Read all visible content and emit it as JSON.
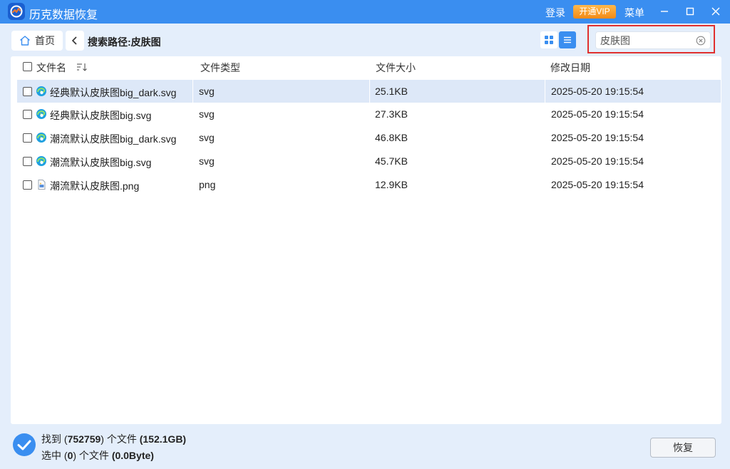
{
  "titlebar": {
    "app_title": "历克数据恢复",
    "login": "登录",
    "vip": "开通VIP",
    "menu": "菜单",
    "accent_color": "#3a8ef0"
  },
  "toolbar": {
    "home_label": "首页",
    "path_label": "搜索路径:",
    "path_value": "皮肤图",
    "view_mode": "list"
  },
  "search": {
    "value": "皮肤图"
  },
  "table": {
    "headers": {
      "name": "文件名",
      "type": "文件类型",
      "size": "文件大小",
      "date": "修改日期"
    },
    "rows": [
      {
        "name": "经典默认皮肤图big_dark.svg",
        "type": "svg",
        "size": "25.1KB",
        "date": "2025-05-20 19:15:54",
        "icon": "edge-icon",
        "selected": true
      },
      {
        "name": "经典默认皮肤图big.svg",
        "type": "svg",
        "size": "27.3KB",
        "date": "2025-05-20 19:15:54",
        "icon": "edge-icon",
        "selected": false
      },
      {
        "name": "潮流默认皮肤图big_dark.svg",
        "type": "svg",
        "size": "46.8KB",
        "date": "2025-05-20 19:15:54",
        "icon": "edge-icon",
        "selected": false
      },
      {
        "name": "潮流默认皮肤图big.svg",
        "type": "svg",
        "size": "45.7KB",
        "date": "2025-05-20 19:15:54",
        "icon": "edge-icon",
        "selected": false
      },
      {
        "name": "潮流默认皮肤图.png",
        "type": "png",
        "size": "12.9KB",
        "date": "2025-05-20 19:15:54",
        "icon": "image-file-icon",
        "selected": false
      }
    ]
  },
  "footer": {
    "found_prefix": "找到 (",
    "found_count": "752759",
    "found_mid": ") 个文件 ",
    "found_size": "(152.1GB)",
    "sel_prefix": "选中 (",
    "sel_count": "0",
    "sel_mid": ") 个文件 ",
    "sel_size": "(0.0Byte)",
    "recover_label": "恢复"
  }
}
